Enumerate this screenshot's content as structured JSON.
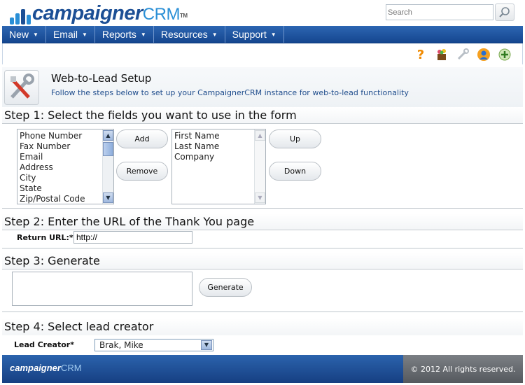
{
  "app": {
    "logo_main": "campaigner",
    "logo_crm": "CRM",
    "logo_tm": "TM"
  },
  "search": {
    "placeholder": "Search"
  },
  "nav": {
    "items": [
      {
        "label": "New"
      },
      {
        "label": "Email"
      },
      {
        "label": "Reports"
      },
      {
        "label": "Resources"
      },
      {
        "label": "Support"
      }
    ]
  },
  "toolbar_icons": [
    "help-icon",
    "gift-icon",
    "tools-icon",
    "user-icon",
    "add-icon"
  ],
  "page": {
    "title": "Web-to-Lead Setup",
    "subtitle": "Follow the steps below to set up your CampaignerCRM instance for web-to-lead functionality"
  },
  "step1": {
    "heading": "Step 1: Select the fields you want to use in the form",
    "available_fields": [
      "Phone Number",
      "Fax Number",
      "Email",
      "Address",
      "City",
      "State",
      "Zip/Postal Code"
    ],
    "selected_fields": [
      "First Name",
      "Last Name",
      "Company"
    ],
    "add_label": "Add",
    "remove_label": "Remove",
    "up_label": "Up",
    "down_label": "Down"
  },
  "step2": {
    "heading": "Step 2: Enter the URL of the Thank You page",
    "return_url_label": "Return URL:*",
    "return_url_value": "http://"
  },
  "step3": {
    "heading": "Step 3: Generate",
    "generate_label": "Generate",
    "code_value": ""
  },
  "step4": {
    "heading": "Step 4: Select lead creator",
    "lead_creator_label": "Lead Creator*",
    "lead_creator_value": "Brak, Mike"
  },
  "footer": {
    "logo_main": "campaigner",
    "logo_crm": "CRM",
    "copyright": "© 2012 All rights reserved."
  }
}
